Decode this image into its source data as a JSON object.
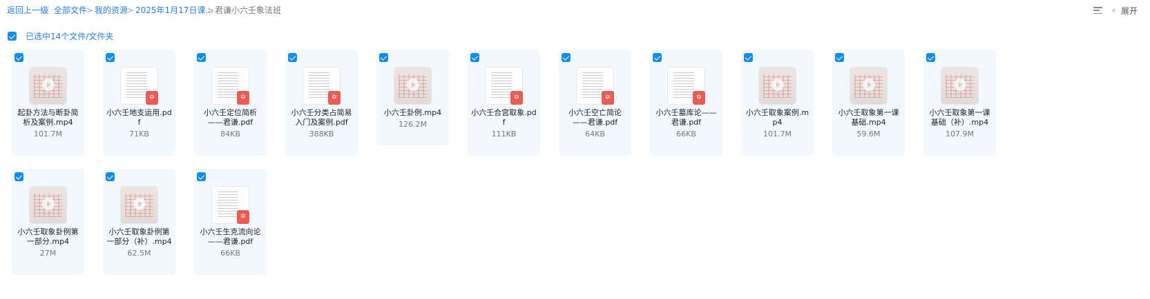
{
  "breadcrumb": {
    "back": "返回上一级",
    "items": [
      "全部文件",
      "我的资源",
      "2025年1月17日课..."
    ],
    "current": "君谦小六壬象法班",
    "separator": ">"
  },
  "toolbar": {
    "list_icon": "list-view-icon",
    "collapse_icon": "chevron-left-icon",
    "expand_label": "展开"
  },
  "selection": {
    "label": "已选中14个文件/文件夹",
    "checked": true
  },
  "colors": {
    "accent": "#2a7de1",
    "checkbox": "#0f8de8",
    "card_bg": "#f1f8fe",
    "pdf_badge": "#ea5b54"
  },
  "files": [
    {
      "name": "起卦方法与断卦简析及案例.mp4",
      "size": "101.7M",
      "type": "video"
    },
    {
      "name": "小六壬地支运用.pdf",
      "size": "71KB",
      "type": "pdf"
    },
    {
      "name": "小六壬定位简析——君谦.pdf",
      "size": "84KB",
      "type": "pdf"
    },
    {
      "name": "小六壬分类占简易入门及案例.pdf",
      "size": "388KB",
      "type": "pdf"
    },
    {
      "name": "小六壬卦例.mp4",
      "size": "126.2M",
      "type": "video"
    },
    {
      "name": "小六壬合宫取象.pdf",
      "size": "111KB",
      "type": "pdf"
    },
    {
      "name": "小六壬空亡简论——君谦.pdf",
      "size": "64KB",
      "type": "pdf"
    },
    {
      "name": "小六壬墓库论——君谦.pdf",
      "size": "66KB",
      "type": "pdf"
    },
    {
      "name": "小六壬取象案例.mp4",
      "size": "101.7M",
      "type": "video"
    },
    {
      "name": "小六壬取象第一课基础.mp4",
      "size": "59.6M",
      "type": "video"
    },
    {
      "name": "小六壬取象第一课基础（补）.mp4",
      "size": "107.9M",
      "type": "video"
    },
    {
      "name": "小六壬取象卦例第一部分.mp4",
      "size": "27M",
      "type": "video"
    },
    {
      "name": "小六壬取象卦例第一部分（补）.mp4",
      "size": "62.5M",
      "type": "video"
    },
    {
      "name": "小六壬生克流向论——君谦.pdf",
      "size": "66KB",
      "type": "pdf"
    }
  ]
}
